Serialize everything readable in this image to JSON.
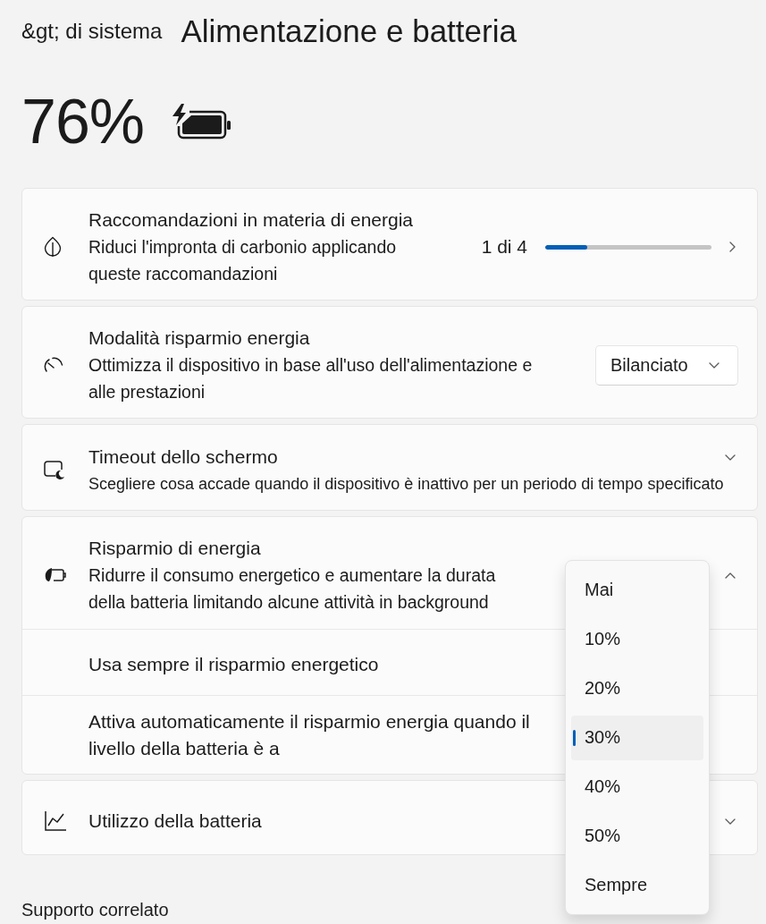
{
  "header": {
    "breadcrumb": "&gt; di sistema",
    "title": "Alimentazione e batteria"
  },
  "battery": {
    "percent": "76%",
    "charging": true
  },
  "energy_recommendations": {
    "title": "Raccomandazioni in materia di energia",
    "description": "Riduci l'impronta di carbonio applicando queste raccomandazioni",
    "counter": "1 di 4",
    "level": 0.25
  },
  "power_mode": {
    "title": "Modalità risparmio energia",
    "description": "Ottimizza il dispositivo in base all'uso dell'alimentazione e alle prestazioni",
    "value": "Bilanciato"
  },
  "screen_timeout": {
    "title": "Timeout dello schermo",
    "description": "Scegliere cosa accade quando il dispositivo è inattivo per un periodo di tempo specificato",
    "expanded": false
  },
  "battery_saver": {
    "title": "Risparmio di energia",
    "description": "Ridurre il consumo energetico e aumentare la durata della batteria limitando alcune attività in background",
    "expanded": true,
    "always_on": {
      "label": "Usa sempre il risparmio energetico"
    },
    "auto_on": {
      "label": "Attiva automaticamente il risparmio energia quando il livello della batteria è a",
      "menu_open": true,
      "options": [
        {
          "label": "Mai",
          "selected": false
        },
        {
          "label": "10%",
          "selected": false
        },
        {
          "label": "20%",
          "selected": false
        },
        {
          "label": "30%",
          "selected": true
        },
        {
          "label": "40%",
          "selected": false
        },
        {
          "label": "50%",
          "selected": false
        },
        {
          "label": "Sempre",
          "selected": false
        }
      ]
    }
  },
  "battery_usage": {
    "title": "Utilizzo della batteria",
    "expanded": false
  },
  "related_support": {
    "title": "Supporto correlato"
  }
}
